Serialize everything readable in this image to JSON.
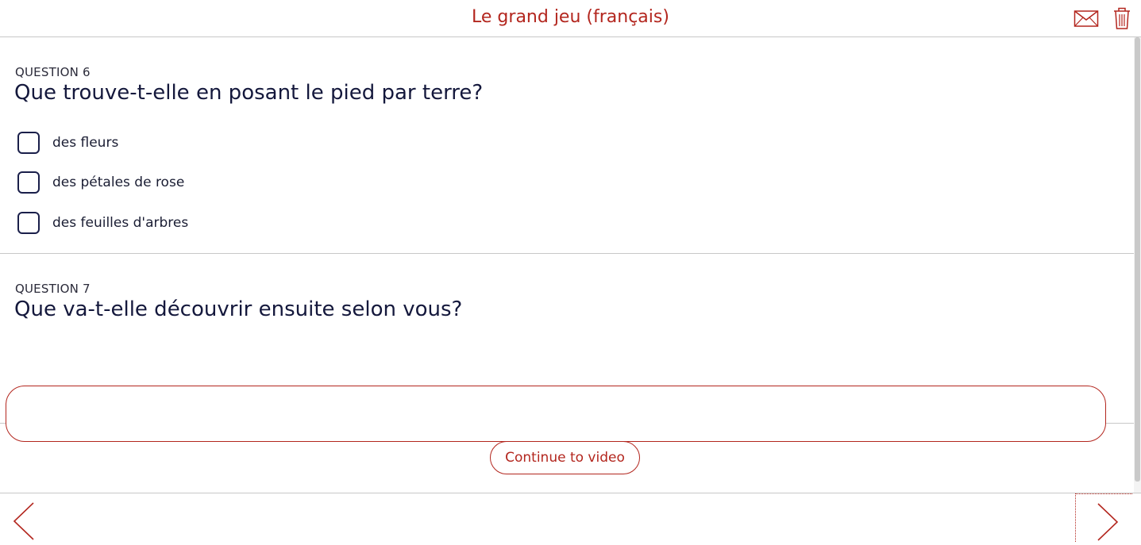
{
  "header": {
    "title": "Le grand jeu (français)",
    "icons": [
      "envelope-icon",
      "trash-icon"
    ]
  },
  "questions": [
    {
      "label": "QUESTION 6",
      "text": "Que trouve-t-elle en posant le pied par terre?",
      "type": "multiple-choice",
      "options": [
        {
          "label": "des fleurs",
          "checked": false
        },
        {
          "label": "des pétales de rose",
          "checked": false
        },
        {
          "label": "des feuilles d'arbres",
          "checked": false
        }
      ]
    },
    {
      "label": "QUESTION 7",
      "text": "Que va-t-elle découvrir ensuite selon vous?",
      "type": "text",
      "value": "",
      "placeholder": ""
    }
  ],
  "actions": {
    "continue_label": "Continue to video"
  },
  "footer": {
    "icons": [
      "chevron-left-icon",
      "chevron-right-icon"
    ]
  },
  "colors": {
    "accent": "#b3261e",
    "text": "#14183c",
    "divider": "#c8c8c8"
  }
}
